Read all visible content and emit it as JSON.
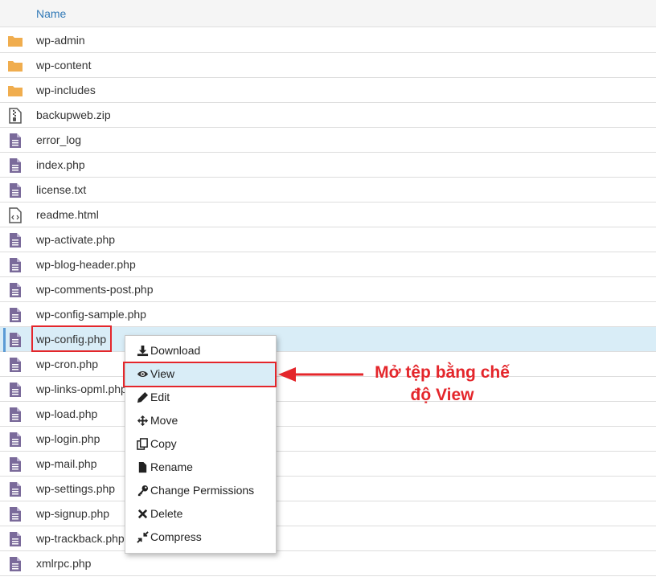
{
  "header": {
    "name_label": "Name"
  },
  "files": [
    {
      "name": "wp-admin",
      "icon": "folder-icon"
    },
    {
      "name": "wp-content",
      "icon": "folder-icon"
    },
    {
      "name": "wp-includes",
      "icon": "folder-icon"
    },
    {
      "name": "backupweb.zip",
      "icon": "zip-file-icon"
    },
    {
      "name": "error_log",
      "icon": "text-file-icon"
    },
    {
      "name": "index.php",
      "icon": "text-file-icon"
    },
    {
      "name": "license.txt",
      "icon": "text-file-icon"
    },
    {
      "name": "readme.html",
      "icon": "code-file-icon"
    },
    {
      "name": "wp-activate.php",
      "icon": "text-file-icon"
    },
    {
      "name": "wp-blog-header.php",
      "icon": "text-file-icon"
    },
    {
      "name": "wp-comments-post.php",
      "icon": "text-file-icon"
    },
    {
      "name": "wp-config-sample.php",
      "icon": "text-file-icon"
    },
    {
      "name": "wp-config.php",
      "icon": "text-file-icon",
      "selected": true
    },
    {
      "name": "wp-cron.php",
      "icon": "text-file-icon"
    },
    {
      "name": "wp-links-opml.php",
      "icon": "text-file-icon"
    },
    {
      "name": "wp-load.php",
      "icon": "text-file-icon"
    },
    {
      "name": "wp-login.php",
      "icon": "text-file-icon"
    },
    {
      "name": "wp-mail.php",
      "icon": "text-file-icon"
    },
    {
      "name": "wp-settings.php",
      "icon": "text-file-icon"
    },
    {
      "name": "wp-signup.php",
      "icon": "text-file-icon"
    },
    {
      "name": "wp-trackback.php",
      "icon": "text-file-icon"
    },
    {
      "name": "xmlrpc.php",
      "icon": "text-file-icon"
    }
  ],
  "context_menu": {
    "items": [
      {
        "label": "Download",
        "icon": "download-icon"
      },
      {
        "label": "View",
        "icon": "eye-icon",
        "active": true
      },
      {
        "label": "Edit",
        "icon": "pencil-icon"
      },
      {
        "label": "Move",
        "icon": "move-arrows-icon"
      },
      {
        "label": "Copy",
        "icon": "copy-icon"
      },
      {
        "label": "Rename",
        "icon": "file-icon"
      },
      {
        "label": "Change Permissions",
        "icon": "key-icon"
      },
      {
        "label": "Delete",
        "icon": "x-icon"
      },
      {
        "label": "Compress",
        "icon": "compress-icon"
      }
    ]
  },
  "annotation": {
    "line1": "Mở tệp bằng chế",
    "line2": "độ View"
  },
  "colors": {
    "highlight": "#e4262b",
    "folder": "#f0ad4e",
    "file": "#7a6a9a",
    "selected_row": "#d9edf7",
    "link": "#337ab7"
  }
}
